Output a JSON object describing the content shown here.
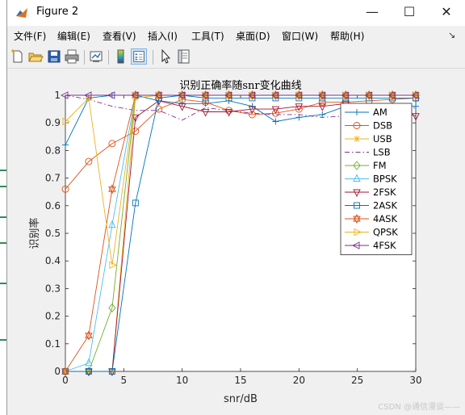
{
  "window": {
    "title": "Figure 2"
  },
  "window_buttons": {
    "minimize": "—",
    "maximize": "☐",
    "close": "✕"
  },
  "menus": [
    "文件(F)",
    "编辑(E)",
    "查看(V)",
    "插入(I)",
    "工具(T)",
    "桌面(D)",
    "窗口(W)",
    "帮助(H)"
  ],
  "menu_dock_glyph": "↘",
  "toolbar": [
    "new-figure-icon",
    "open-file-icon",
    "save-icon",
    "print-icon",
    "link-plot-icon",
    "insert-colorbar-icon",
    "insert-legend-icon",
    "edit-plot-arrow-icon",
    "property-inspector-icon"
  ],
  "colors": {
    "titlebar": "#ffffff",
    "window_bg": "#f0f0f0",
    "toolbar_active": "#cce4f7"
  },
  "chart_data": {
    "type": "line",
    "title": "识别正确率随snr变化曲线",
    "xlabel": "snr/dB",
    "ylabel": "识别率",
    "xlim": [
      0,
      30
    ],
    "ylim": [
      0,
      1
    ],
    "xticks": [
      0,
      5,
      10,
      15,
      20,
      25,
      30
    ],
    "yticks": [
      0,
      0.1,
      0.2,
      0.3,
      0.4,
      0.5,
      0.6,
      0.7,
      0.8,
      0.9,
      1
    ],
    "xtick_labels": [
      "0",
      "5",
      "10",
      "15",
      "20",
      "25",
      "30"
    ],
    "ytick_labels": [
      "0",
      "0.1",
      "0.2",
      "0.3",
      "0.4",
      "0.5",
      "0.6",
      "0.7",
      "0.8",
      "0.9",
      "1"
    ],
    "grid": false,
    "legend": "upper-right",
    "x": [
      0,
      2,
      4,
      6,
      8,
      10,
      12,
      14,
      16,
      18,
      20,
      22,
      24,
      26,
      28,
      30
    ],
    "series": [
      {
        "name": "AM",
        "color": "#0072BD",
        "marker": "plus",
        "dash": "solid",
        "values": [
          0.82,
          0.99,
          1,
          1,
          0.98,
          0.97,
          0.97,
          0.98,
          0.96,
          0.905,
          0.92,
          0.93,
          0.96,
          0.96,
          0.96,
          0.96
        ]
      },
      {
        "name": "DSB",
        "color": "#D95319",
        "marker": "circle",
        "dash": "solid",
        "values": [
          0.66,
          0.76,
          0.825,
          0.87,
          0.95,
          0.985,
          0.975,
          0.945,
          0.93,
          0.935,
          0.95,
          0.975,
          0.975,
          0.98,
          0.985,
          0.99
        ]
      },
      {
        "name": "USB",
        "color": "#EDB120",
        "marker": "asterisk",
        "dash": "solid",
        "values": [
          0,
          0,
          0,
          0.99,
          1,
          1,
          1,
          1,
          1,
          1,
          1,
          1,
          1,
          1,
          1,
          1
        ]
      },
      {
        "name": "LSB",
        "color": "#7E2F8E",
        "marker": "none",
        "dash": "dashdot",
        "values": [
          1,
          0.985,
          0.96,
          0.945,
          0.945,
          0.91,
          0.955,
          0.945,
          0.935,
          0.93,
          0.93,
          0.92,
          0.925,
          0.93,
          0.94,
          0.955
        ]
      },
      {
        "name": "FM",
        "color": "#77AC30",
        "marker": "diamond",
        "dash": "solid",
        "values": [
          0,
          0,
          0.23,
          1,
          1,
          1,
          1,
          1,
          1,
          1,
          1,
          1,
          1,
          1,
          1,
          1
        ]
      },
      {
        "name": "BPSK",
        "color": "#4DBEEE",
        "marker": "triangle",
        "dash": "solid",
        "values": [
          0,
          0.03,
          0.53,
          1,
          1,
          1,
          1,
          1,
          1,
          1,
          1,
          1,
          1,
          1,
          1,
          1
        ]
      },
      {
        "name": "2FSK",
        "color": "#A2142F",
        "marker": "tri-down",
        "dash": "solid",
        "values": [
          0,
          0,
          0,
          0.92,
          0.98,
          0.96,
          0.94,
          0.94,
          0.95,
          0.95,
          0.96,
          0.96,
          0.97,
          0.96,
          0.95,
          0.925
        ]
      },
      {
        "name": "2ASK",
        "color": "#0072BD",
        "marker": "square",
        "dash": "solid",
        "values": [
          0,
          0,
          0,
          0.61,
          0.99,
          1,
          0.99,
          0.99,
          0.99,
          0.99,
          0.99,
          0.99,
          0.99,
          0.99,
          0.99,
          0.99
        ]
      },
      {
        "name": "4ASK",
        "color": "#D95319",
        "marker": "hexagram",
        "dash": "solid",
        "values": [
          0,
          0.13,
          0.66,
          1,
          1,
          1,
          1,
          1,
          1,
          1,
          1,
          1,
          1,
          1,
          1,
          1
        ]
      },
      {
        "name": "QPSK",
        "color": "#EDB120",
        "marker": "tri-right",
        "dash": "solid",
        "values": [
          0.905,
          0.99,
          0.385,
          1,
          1,
          1,
          1,
          1,
          1,
          1,
          1,
          1,
          1,
          1,
          1,
          1
        ]
      },
      {
        "name": "4FSK",
        "color": "#7E2F8E",
        "marker": "tri-left",
        "dash": "solid",
        "values": [
          1,
          1,
          1,
          1,
          1,
          1,
          1,
          1,
          1,
          1,
          1,
          1,
          1,
          1,
          1,
          1
        ]
      }
    ]
  },
  "watermark": "CSDN @通信漫谈——"
}
